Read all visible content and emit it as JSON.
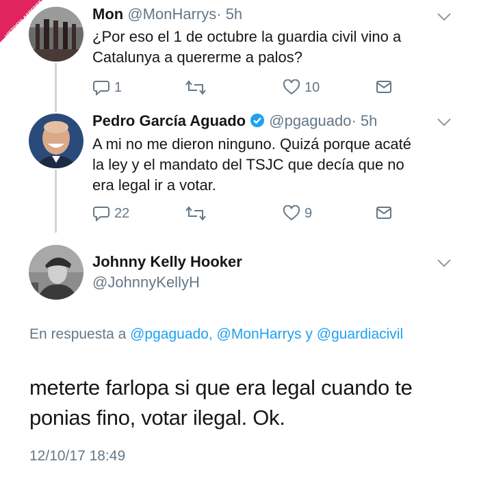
{
  "watermark": {
    "text": "VISTOENLASREDES",
    "sub": ".com"
  },
  "tweets": [
    {
      "name": "Mon",
      "handle": "@MonHarrys",
      "dot": "·",
      "time": "5h",
      "text": "¿Por eso el 1 de octubre la guardia civil vino a Catalunya a quererme a palos?",
      "replies": "1",
      "retweets": "",
      "likes": "10"
    },
    {
      "name": "Pedro García Aguado",
      "handle": "@pgaguado",
      "dot": "·",
      "time": "5h",
      "text_lines": [
        "A mi no me dieron ninguno. Quizá porque acaté",
        "la ley y el mandato del TSJC que decía que no",
        "era legal ir a votar."
      ],
      "replies": "22",
      "retweets": "",
      "likes": "9"
    }
  ],
  "main_tweet": {
    "name": "Johnny Kelly Hooker",
    "handle": "@JohnnyKellyH",
    "reply_prefix": "En respuesta a",
    "mention1": "@pgaguado,",
    "mention2": "@MonHarrys",
    "conj": "y",
    "mention3": "@guardiacivil",
    "text_lines": [
      "meterte farlopa si que era legal cuando te",
      "ponias fino, votar ilegal. Ok."
    ],
    "date": "12/10/17 18:49"
  },
  "colors": {
    "link": "#1da1f2",
    "muted": "#657786",
    "verified": "#1da1f2"
  }
}
